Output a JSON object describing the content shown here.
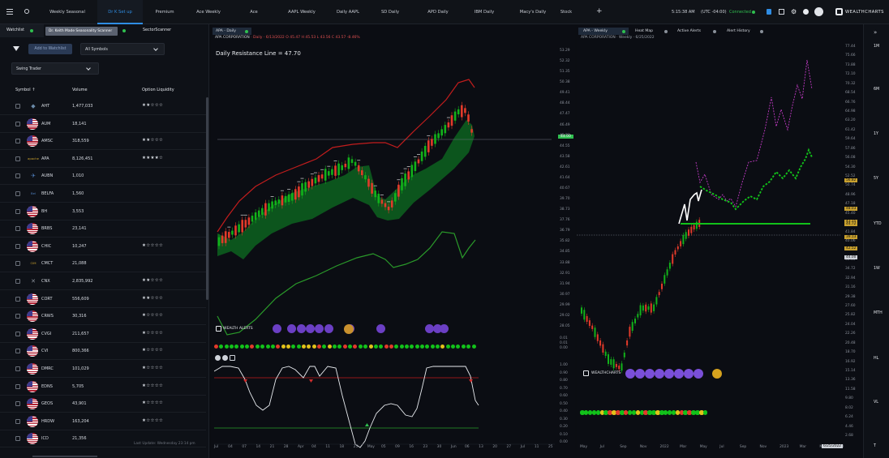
{
  "top_tabs": [
    "Weekly Seasonal",
    "Dr K Set up",
    "Premium",
    "Ace Weekly",
    "Ace",
    "AAPL Weekly",
    "Daily AAPL",
    "SD Daily",
    "APD Daily",
    "IBM Daily",
    "Macy's Daily",
    "Stock"
  ],
  "active_tab_index": 1,
  "clock": "5:15:38 AM",
  "timezone": "(UTC -04:00)",
  "connection": "Connected",
  "brand": "WEALTHCHARTS",
  "left": {
    "tab_watchlist": "Watchlist",
    "tab_scanner": "Dr. Keith Made Seasonality Scanner",
    "tab_sector": "SectorScanner",
    "add_btn": "Add to Watchlist",
    "symbols_select": "All Symbols",
    "strategy_select": "Swing Trader",
    "col_symbol": "Symbol",
    "col_volume": "Volume",
    "col_liquidity": "Option Liquidity",
    "footer": "Last Update: Wednesday 23:14 pm",
    "rows": [
      {
        "sym": "AHT",
        "vol": "1,477,033",
        "stars": "★★☆☆☆",
        "logo": "hex"
      },
      {
        "sym": "AUM",
        "vol": "18,141",
        "stars": "",
        "logo": "us"
      },
      {
        "sym": "AMSC",
        "vol": "318,559",
        "stars": "★★☆☆☆",
        "logo": "us"
      },
      {
        "sym": "APA",
        "vol": "8,126,451",
        "stars": "★★★★☆",
        "logo": "apache"
      },
      {
        "sym": "AUBN",
        "vol": "1,010",
        "stars": "",
        "logo": "eagle"
      },
      {
        "sym": "BELFA",
        "vol": "1,560",
        "stars": "",
        "logo": "belfuse"
      },
      {
        "sym": "BH",
        "vol": "3,553",
        "stars": "",
        "logo": "us"
      },
      {
        "sym": "BRBS",
        "vol": "23,141",
        "stars": "",
        "logo": "us"
      },
      {
        "sym": "CHIC",
        "vol": "10,247",
        "stars": "★☆☆☆☆",
        "logo": "us"
      },
      {
        "sym": "CMCT",
        "vol": "21,088",
        "stars": "",
        "logo": "cim"
      },
      {
        "sym": "CNX",
        "vol": "2,835,992",
        "stars": "★★☆☆☆",
        "logo": "cnx"
      },
      {
        "sym": "CORT",
        "vol": "556,609",
        "stars": "★★☆☆☆",
        "logo": "us"
      },
      {
        "sym": "CRWS",
        "vol": "30,316",
        "stars": "★☆☆☆☆",
        "logo": "us"
      },
      {
        "sym": "CVGI",
        "vol": "211,657",
        "stars": "★☆☆☆☆",
        "logo": "us"
      },
      {
        "sym": "CVI",
        "vol": "800,366",
        "stars": "★☆☆☆☆",
        "logo": "us"
      },
      {
        "sym": "DMRC",
        "vol": "101,029",
        "stars": "★☆☆☆☆",
        "logo": "us"
      },
      {
        "sym": "EDNS",
        "vol": "5,705",
        "stars": "★☆☆☆☆",
        "logo": "us"
      },
      {
        "sym": "GEOS",
        "vol": "43,901",
        "stars": "★☆☆☆☆",
        "logo": "us"
      },
      {
        "sym": "HRDW",
        "vol": "163,204",
        "stars": "★☆☆☆☆",
        "logo": "us"
      },
      {
        "sym": "ICD",
        "vol": "21,356",
        "stars": "",
        "logo": "us"
      }
    ]
  },
  "mid": {
    "tab": "APA - Daily",
    "info_name": "APA CORPORATION",
    "info_rest": "· Daily · 6/13/2022 O 45.47 H 45.53 L 43.56 C 43.57 -8.46%",
    "resistance": "Daily Resistance Line = 47.70",
    "price_badge": "44.00",
    "y_ticks": [
      "53.29",
      "52.32",
      "51.35",
      "50.38",
      "49.41",
      "48.44",
      "47.47",
      "46.49",
      "45.52",
      "44.55",
      "43.58",
      "42.61",
      "41.64",
      "40.67",
      "39.70",
      "38.73",
      "37.76",
      "36.79",
      "35.82",
      "34.85",
      "33.88",
      "32.91",
      "31.94",
      "30.97",
      "29.99",
      "29.02",
      "28.05"
    ],
    "ind_ticks": [
      "1.00",
      "0.90",
      "0.80",
      "0.70",
      "0.60",
      "0.50",
      "0.40",
      "0.30",
      "0.20",
      "0.10",
      "0.00"
    ],
    "ind_small": [
      "0.01",
      "0.01",
      "0.00"
    ],
    "x_ticks": [
      "Jul",
      "04",
      "07",
      "14",
      "21",
      "28",
      "Apr",
      "04",
      "11",
      "18",
      "25",
      "May",
      "05",
      "09",
      "16",
      "23",
      "30",
      "Jun",
      "06",
      "13",
      "20",
      "27",
      "Jul",
      "11",
      "25"
    ],
    "wealth_label": "WEALTH ALERTS"
  },
  "right": {
    "tab_main": "APA - Weekly",
    "tab_heat": "Heat Map",
    "tab_active": "Active Alerts",
    "tab_history": "Alert History",
    "info": "APA CORPORATION · Weekly · 6/25/2022",
    "y_ticks": [
      "77.44",
      "75.66",
      "73.88",
      "72.10",
      "70.32",
      "68.54",
      "66.76",
      "64.98",
      "63.20",
      "61.42",
      "59.64",
      "57.86",
      "56.08",
      "54.30",
      "52.52",
      "50.74",
      "48.96",
      "47.18",
      "45.40",
      "43.62",
      "41.84",
      "40.06",
      "38.28",
      "36.50",
      "34.72",
      "32.94",
      "31.16",
      "29.38",
      "27.60",
      "25.82",
      "24.04",
      "22.26",
      "20.48",
      "18.70",
      "16.92",
      "15.14",
      "13.36",
      "11.58",
      "9.80",
      "8.02",
      "6.24",
      "4.46",
      "2.68"
    ],
    "badges": [
      "56.82",
      "48.03",
      "43.15",
      "44.72",
      "39.13",
      "42.52",
      "44.00"
    ],
    "x_ticks": [
      "May",
      "Jul",
      "Sep",
      "Nov",
      "2022",
      "Mar",
      "May",
      "Jul",
      "Sep",
      "Nov",
      "2023",
      "Mar",
      "May",
      "Jul"
    ],
    "x_badge": "6/25/2022",
    "wealth_label": "WEALTHCHARTS"
  },
  "side": {
    "labels": [
      "1M",
      "6M",
      "1Y",
      "5Y",
      "YTD",
      "1W",
      "MTH",
      "HL",
      "VL",
      "T"
    ]
  }
}
